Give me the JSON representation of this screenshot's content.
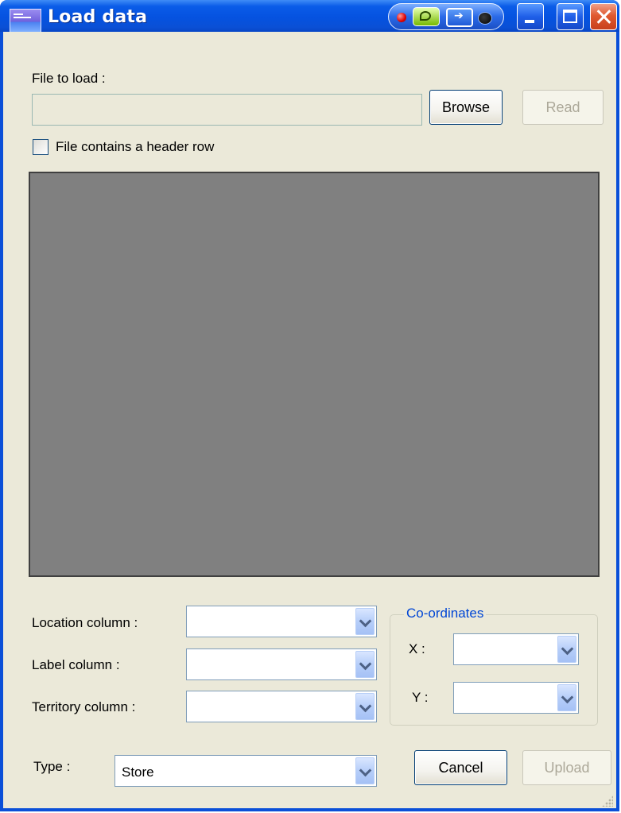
{
  "window": {
    "title": "Load data"
  },
  "file": {
    "label": "File to load :",
    "value": "",
    "browse_label": "Browse",
    "read_label": "Read"
  },
  "header_checkbox": {
    "label": "File contains a header row",
    "checked": false
  },
  "columns": {
    "location": {
      "label": "Location column :",
      "value": ""
    },
    "label": {
      "label": "Label column :",
      "value": ""
    },
    "territory": {
      "label": "Territory column :",
      "value": ""
    }
  },
  "coordinates": {
    "title": "Co-ordinates",
    "x": {
      "label": "X :",
      "value": ""
    },
    "y": {
      "label": "Y :",
      "value": ""
    }
  },
  "type": {
    "label": "Type :",
    "value": "Store"
  },
  "actions": {
    "cancel_label": "Cancel",
    "upload_label": "Upload"
  },
  "icons": [
    "app-icon",
    "record-icon",
    "nvidia-icon",
    "exit-icon",
    "minimize-icon",
    "maximize-icon",
    "close-icon",
    "chevron-down-icon",
    "resize-grip-icon"
  ]
}
